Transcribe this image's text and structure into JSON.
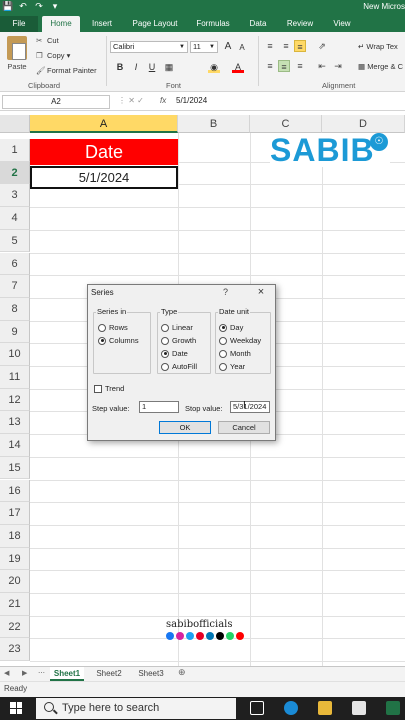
{
  "window": {
    "title": "New Micros"
  },
  "quick_access": {
    "icons": [
      "save-icon",
      "undo-icon",
      "redo-icon",
      "customize-icon"
    ]
  },
  "ribbon": {
    "tabs": [
      "File",
      "Home",
      "Insert",
      "Page Layout",
      "Formulas",
      "Data",
      "Review",
      "View"
    ],
    "active_tab": "Home",
    "clipboard": {
      "paste": "Paste",
      "cut": "Cut",
      "copy": "Copy",
      "format_painter": "Format Painter",
      "label": "Clipboard"
    },
    "font": {
      "name": "Calibri",
      "size": "11",
      "bold": "B",
      "italic": "I",
      "underline": "U",
      "grow": "A",
      "shrink": "A",
      "label": "Font"
    },
    "alignment": {
      "wrap": "Wrap Tex",
      "merge": "Merge & C",
      "label": "Alignment"
    }
  },
  "formula_bar": {
    "name_box": "A2",
    "fx": "fx",
    "value": "5/1/2024"
  },
  "grid": {
    "columns": [
      "A",
      "B",
      "C",
      "D"
    ],
    "selected_column": "A",
    "rows": [
      "1",
      "2",
      "3",
      "4",
      "5",
      "6",
      "7",
      "8",
      "9",
      "10",
      "11",
      "12",
      "13",
      "14",
      "15",
      "16",
      "17",
      "18",
      "19",
      "20",
      "21",
      "22",
      "23"
    ],
    "selected_row": "2",
    "cells": {
      "A1": "Date",
      "A2": "5/1/2024"
    }
  },
  "logo": {
    "text": "SABIB"
  },
  "watermark": {
    "text": "sabibofficials"
  },
  "dialog": {
    "title": "Series",
    "help": "?",
    "close": "×",
    "series_in": {
      "legend": "Series in",
      "options": [
        "Rows",
        "Columns"
      ],
      "selected": "Columns"
    },
    "type": {
      "legend": "Type",
      "options": [
        "Linear",
        "Growth",
        "Date",
        "AutoFill"
      ],
      "selected": "Date"
    },
    "date_unit": {
      "legend": "Date unit",
      "options": [
        "Day",
        "Weekday",
        "Month",
        "Year"
      ],
      "selected": "Day"
    },
    "trend": "Trend",
    "step_label": "Step value:",
    "step_value": "1",
    "stop_label": "Stop value:",
    "stop_value": "5/31/2024",
    "ok": "OK",
    "cancel": "Cancel"
  },
  "sheets": {
    "tabs": [
      "Sheet1",
      "Sheet2",
      "Sheet3"
    ],
    "active": "Sheet1"
  },
  "status": {
    "text": "Ready"
  },
  "taskbar": {
    "search_placeholder": "Type here to search"
  },
  "colors": {
    "excel_green": "#217346",
    "header_red": "#ff0000",
    "logo_blue": "#1c9ad6",
    "col_highlight": "#ffd966"
  }
}
